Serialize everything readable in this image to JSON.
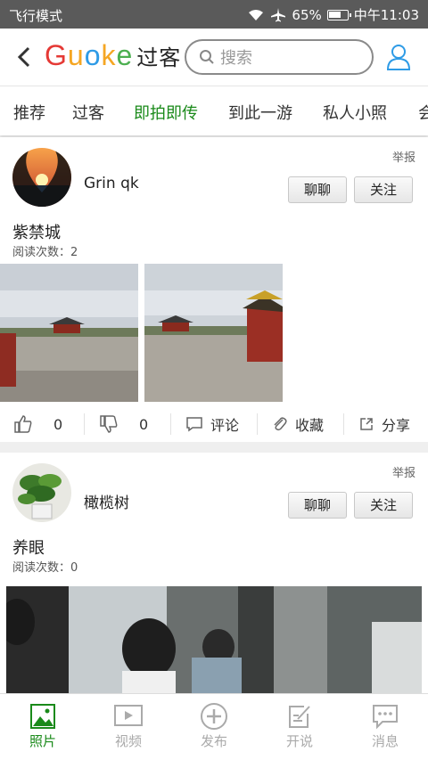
{
  "status": {
    "mode": "飞行模式",
    "battery": "65%",
    "time": "中午11:03"
  },
  "header": {
    "logo": [
      {
        "ch": "G",
        "color": "#e53935"
      },
      {
        "ch": "u",
        "color": "#f5a623"
      },
      {
        "ch": "o",
        "color": "#2e9be6"
      },
      {
        "ch": "k",
        "color": "#f5a623"
      },
      {
        "ch": "e",
        "color": "#4caf50"
      }
    ],
    "logo_cn": "过客",
    "search_placeholder": "搜索"
  },
  "tabs": [
    "推荐",
    "过客",
    "即拍即传",
    "到此一游",
    "私人小照",
    "会"
  ],
  "active_tab": 2,
  "posts": [
    {
      "user": "Grin qk",
      "report": "举报",
      "chat": "聊聊",
      "follow": "关注",
      "title": "紫禁城",
      "reads": "阅读次数：2",
      "likes": "0",
      "dislikes": "0",
      "comment": "评论",
      "favorite": "收藏",
      "share": "分享"
    },
    {
      "user": "橄榄树",
      "report": "举报",
      "chat": "聊聊",
      "follow": "关注",
      "title": "养眼",
      "reads": "阅读次数：0"
    }
  ],
  "nav": [
    {
      "label": "照片",
      "icon": "photo-icon"
    },
    {
      "label": "视频",
      "icon": "video-icon"
    },
    {
      "label": "发布",
      "icon": "publish-icon"
    },
    {
      "label": "开说",
      "icon": "talk-icon"
    },
    {
      "label": "消息",
      "icon": "message-icon"
    }
  ],
  "colors": {
    "accent": "#1a8a1a",
    "statusbar": "#5a5a5a"
  }
}
